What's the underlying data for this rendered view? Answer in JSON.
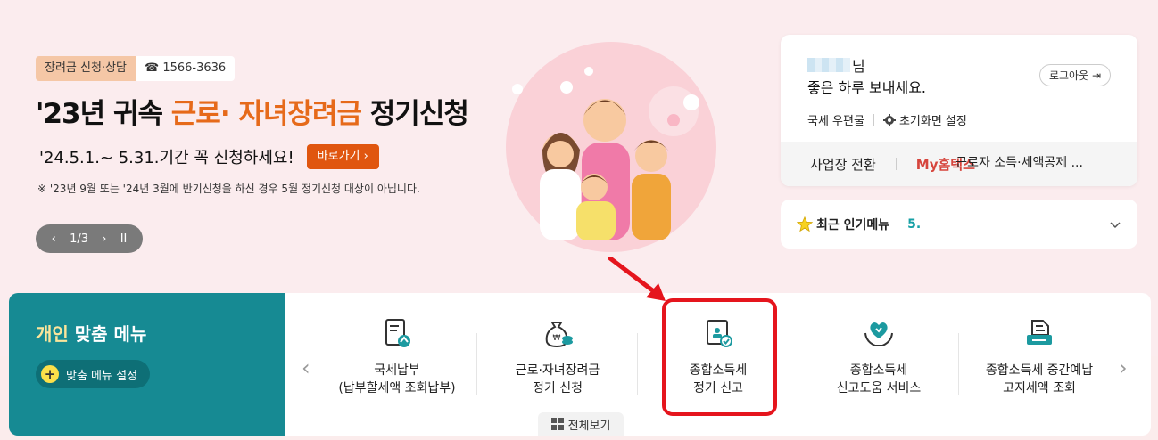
{
  "banner": {
    "tag_apply": "장려금 신청·상담",
    "tag_phone": "☎ 1566-3636",
    "headline_pre": "'23년 귀속 ",
    "headline_highlight": "근로· 자녀장려금",
    "headline_post": " 정기신청",
    "subline": "'24.5.1.~ 5.31.기간 꼭 신청하세요!",
    "go_button": "바로가기 ›",
    "note": "※ '23년 9월 또는 '24년 3월에 반기신청을 하신 경우 5월 정기신청 대상이 아닙니다.",
    "pager": {
      "prev": "‹",
      "page": "1/3",
      "next": "›",
      "pause": "II"
    }
  },
  "user": {
    "name_suffix": "님",
    "greeting": "좋은 하루 보내세요.",
    "logout": "로그아웃 ⇥",
    "mailbox": "국세 우편물",
    "settings_icon": "gear-icon",
    "settings": "초기화면 설정",
    "switch_business": "사업장 전환",
    "my_hometax": "My홈택스"
  },
  "popular": {
    "icon": "star-icon",
    "title": "최근 인기메뉴",
    "rank": "5.",
    "item": "근로자 소득·세액공제 ..."
  },
  "menu": {
    "title_highlight": "개인",
    "title_rest": " 맞춤 메뉴",
    "setting_label": "맞춤 메뉴 설정",
    "prev": "‹",
    "next": "›",
    "items": [
      {
        "label": "국세납부\n(납부할세액 조회납부)",
        "icon": "document-upload-icon"
      },
      {
        "label": "근로·자녀장려금\n정기 신청",
        "icon": "money-bag-icon"
      },
      {
        "label": "종합소득세\n정기 신고",
        "icon": "certificate-icon"
      },
      {
        "label": "종합소득세\n신고도움 서비스",
        "icon": "heart-hands-icon"
      },
      {
        "label": "종합소득세 중간예납\n고지세액 조회",
        "icon": "printer-doc-icon"
      }
    ],
    "view_all": "전체보기"
  },
  "colors": {
    "accent": "#168a93",
    "highlight_border": "#e5151d",
    "orange": "#e0560f"
  }
}
